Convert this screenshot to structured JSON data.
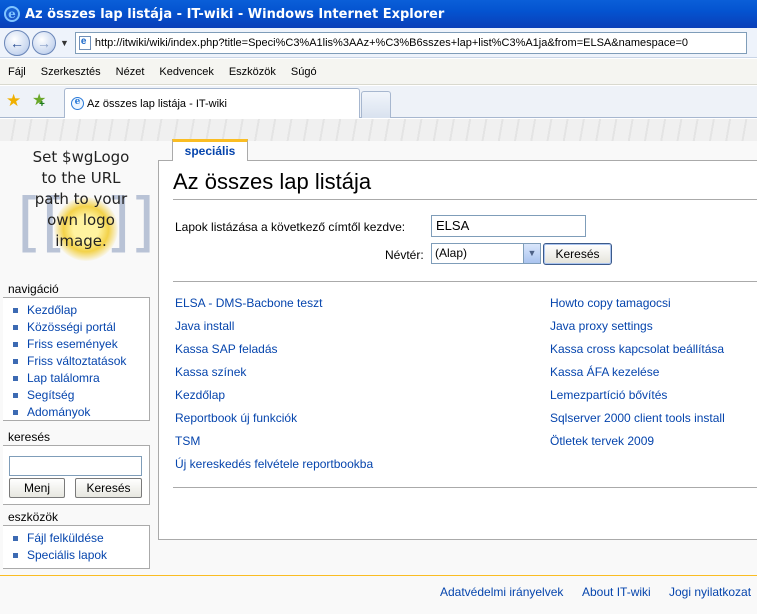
{
  "window": {
    "title": "Az összes lap listája - IT-wiki - Windows Internet Explorer"
  },
  "address": {
    "url": "http://itwiki/wiki/index.php?title=Speci%C3%A1lis%3AAz+%C3%B6sszes+lap+list%C3%A1ja&from=ELSA&namespace=0"
  },
  "menu": {
    "items": [
      "Fájl",
      "Szerkesztés",
      "Nézet",
      "Kedvencek",
      "Eszközök",
      "Súgó"
    ]
  },
  "tab": {
    "label": "Az összes lap listája - IT-wiki"
  },
  "logo": {
    "text": [
      "Set $wgLogo",
      "to the URL",
      "path to your",
      "own logo",
      "image."
    ]
  },
  "sidebar": {
    "navigation": {
      "title": "navigáció",
      "items": [
        "Kezdőlap",
        "Közösségi portál",
        "Friss események",
        "Friss változtatások",
        "Lap találomra",
        "Segítség",
        "Adományok"
      ]
    },
    "search": {
      "title": "keresés",
      "go_label": "Menj",
      "search_label": "Keresés",
      "value": ""
    },
    "tools": {
      "title": "eszközök",
      "items": [
        "Fájl felküldése",
        "Speciális lapok"
      ]
    }
  },
  "page": {
    "tab_label": "speciális",
    "title": "Az összes lap listája",
    "from_label": "Lapok listázása a következő címtől kezdve:",
    "from_value": "ELSA",
    "namespace_label": "Névtér:",
    "namespace_value": "(Alap)",
    "search_button": "Keresés",
    "links_left": [
      "ELSA - DMS-Bacbone teszt",
      "Java install",
      "Kassa SAP feladás",
      "Kassa színek",
      "Kezdőlap",
      "Reportbook új funkciók",
      "TSM",
      "Új kereskedés felvétele reportbookba"
    ],
    "links_right": [
      "Howto copy tamagocsi",
      "Java proxy settings",
      "Kassa cross kapcsolat beállítása",
      "Kassa ÁFA kezelése",
      "Lemezpartíció bővítés",
      "Sqlserver 2000 client tools install",
      "Ötletek tervek 2009"
    ]
  },
  "footer": {
    "links": [
      "Adatvédelmi irányelvek",
      "About IT-wiki",
      "Jogi nyilatkozat"
    ]
  },
  "colors": {
    "link": "#0645ad",
    "accent": "#fabd23",
    "titlebar": "#0453d0"
  }
}
